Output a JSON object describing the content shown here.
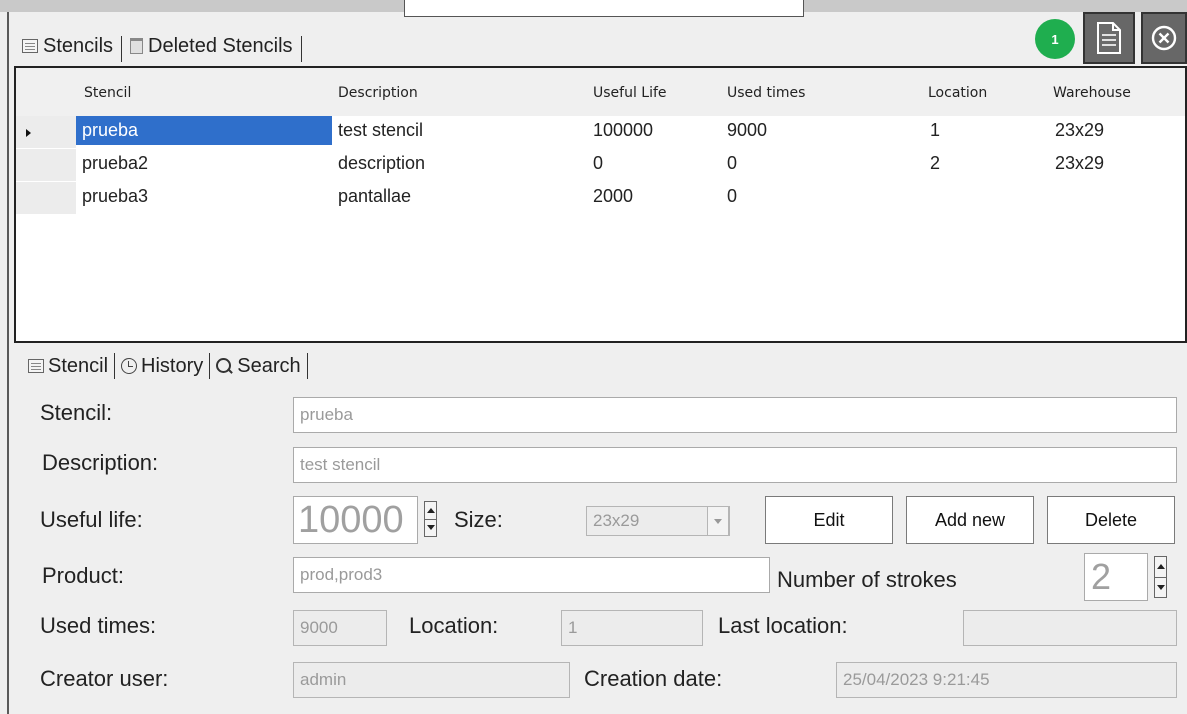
{
  "tabs": {
    "stencils": "Stencils",
    "deleted": "Deleted Stencils"
  },
  "toolbar": {
    "badge_count": "1",
    "report_icon": "document-icon",
    "close_icon": "close-circle-icon",
    "badge_color": "#1fae4f"
  },
  "grid": {
    "columns": [
      "Stencil",
      "Description",
      "Useful Life",
      "Used times",
      "Location",
      "Warehouse"
    ],
    "rows": [
      [
        "prueba",
        "test stencil",
        "100000",
        "9000",
        "1",
        "23x29"
      ],
      [
        "prueba2",
        "description",
        "0",
        "0",
        "2",
        "23x29"
      ],
      [
        "prueba3",
        "pantallae",
        "2000",
        "0",
        "",
        ""
      ]
    ],
    "selected_color": "#2f6fcb"
  },
  "lower_tabs": {
    "stencil": "Stencil",
    "history": "History",
    "search": "Search"
  },
  "form": {
    "stencil_label": "Stencil:",
    "stencil_value": "prueba",
    "description_label": "Description:",
    "description_value": "test stencil",
    "useful_life_label": "Useful life:",
    "useful_life_value": "10000",
    "size_label": "Size:",
    "size_value": "23x29",
    "product_label": "Product:",
    "product_value": "prod,prod3",
    "strokes_label": "Number of strokes",
    "strokes_value": "2",
    "used_times_label": "Used times:",
    "used_times_value": "9000",
    "location_label": "Location:",
    "location_value": "1",
    "last_location_label": "Last location:",
    "last_location_value": "",
    "creator_label": "Creator user:",
    "creator_value": "admin",
    "creation_date_label": "Creation date:",
    "creation_date_value": "25/04/2023 9:21:45"
  },
  "buttons": {
    "edit": "Edit",
    "add_new": "Add new",
    "delete": "Delete"
  }
}
